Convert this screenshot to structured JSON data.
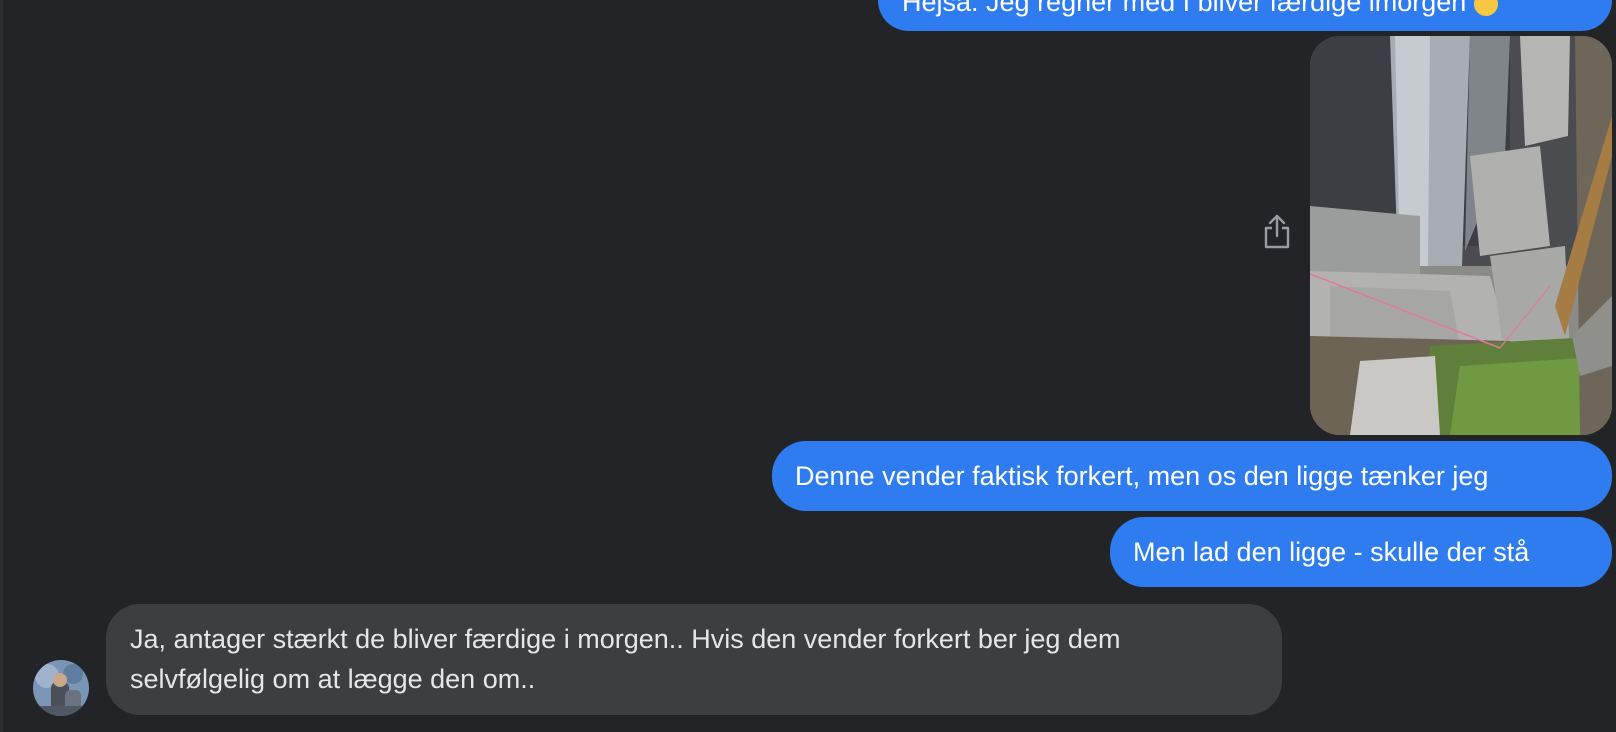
{
  "conversation": {
    "messages": [
      {
        "sender": "me",
        "text": "Hejsa. Jeg regner med I bliver færdige imorgen",
        "emoji": "thumbs-up-emoji"
      },
      {
        "sender": "me",
        "type": "image",
        "image_desc": "photo of paving stones and metal post"
      },
      {
        "sender": "me",
        "text": "Denne vender faktisk forkert, men os den ligge tænker jeg"
      },
      {
        "sender": "me",
        "text": "Men lad den ligge - skulle der stå"
      },
      {
        "sender": "other",
        "text": "Ja, antager stærkt de bliver færdige i morgen.. Hvis den vender forkert ber jeg dem selvfølgelig om at lægge den om.."
      }
    ],
    "share_icon": "share-icon",
    "avatar_icon": "contact-avatar"
  },
  "colors": {
    "background": "#232427",
    "outgoing_bubble": "#2f7cf0",
    "incoming_bubble": "#3d3e42"
  }
}
